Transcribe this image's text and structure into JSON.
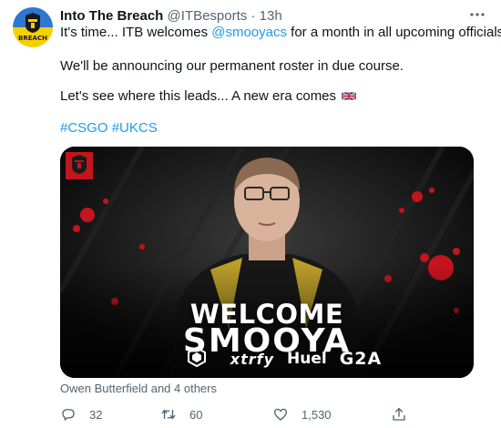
{
  "tweet": {
    "author": {
      "display_name": "Into The Breach",
      "handle": "@ITBesports",
      "separator": "·",
      "time": "13h",
      "avatar_text": "BREACH"
    },
    "lines": {
      "line1_prefix": "It's time... ITB welcomes ",
      "line1_mention": "@smooyacs",
      "line1_suffix": " for a month in all upcoming officials.",
      "line2": "We'll be announcing our permanent roster in due course.",
      "line3": "Let's see where this leads... A new era comes",
      "hashtag1": "#CSGO",
      "hashtag2": "#UKCS"
    },
    "media": {
      "headline_1": "WELCOME",
      "headline_2": "SMOOYA",
      "sponsors": {
        "xtrfy": "xtrfy",
        "huel": "Huel",
        "g2a": "G2A"
      }
    },
    "liked_by": "Owen Butterfield and 4 others",
    "actions": {
      "reply_count": "32",
      "retweet_count": "60",
      "like_count": "1,530"
    },
    "icons": {
      "more": "more-icon",
      "reply": "reply-icon",
      "retweet": "retweet-icon",
      "like": "heart-icon",
      "share": "share-icon",
      "flag": "uk-flag-icon"
    },
    "colors": {
      "link": "#1d9bf0",
      "text": "#0f1419",
      "secondary": "#536471",
      "avatar_top": "#2e77d0",
      "avatar_bottom": "#f5d000",
      "accent_red": "#c4141c"
    }
  }
}
